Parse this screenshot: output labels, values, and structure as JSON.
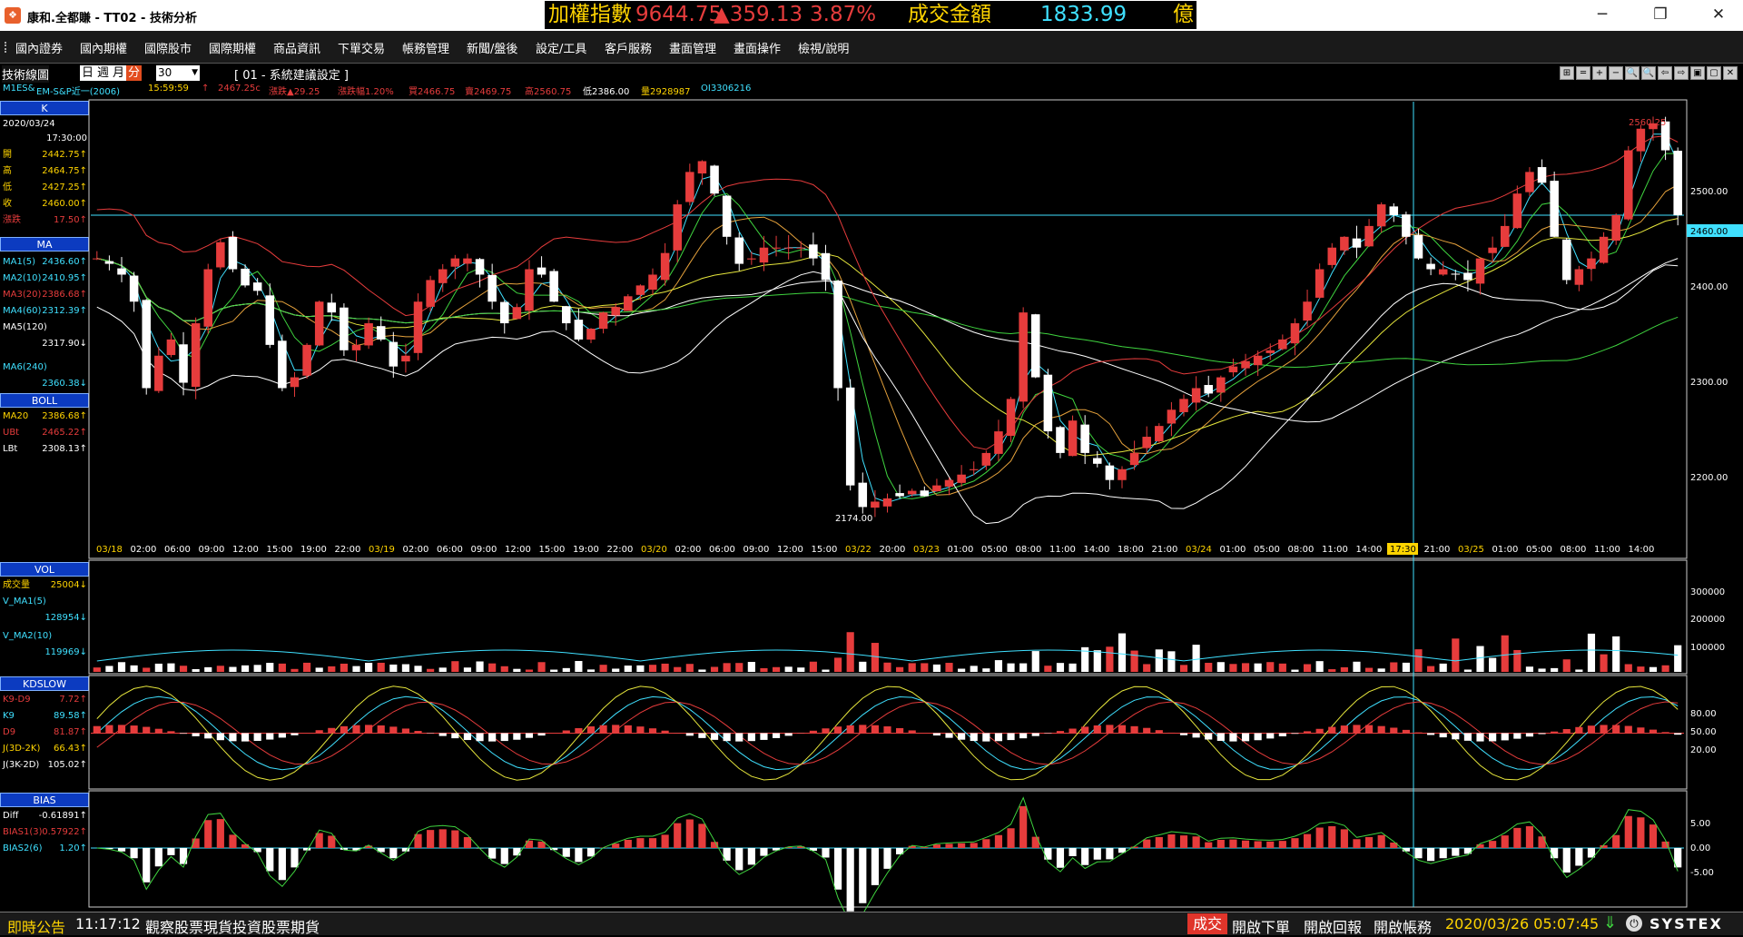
{
  "window": {
    "title": "康和.全都賺 - TT02 - 技術分析",
    "logo_glyph": "❖",
    "controls": {
      "minimize": "─",
      "maximize": "❐",
      "close": "✕"
    }
  },
  "ticker": {
    "name": "加權指數",
    "value": "9644.75",
    "change": "▲359.13",
    "percent": "3.87%",
    "amount_label": "成交金額",
    "amount": "1833.99",
    "unit": "億",
    "colors": {
      "name": "#ffd400",
      "value": "#e63c3c",
      "amount": "#3fe0ff"
    }
  },
  "menu": [
    "國內證券",
    "國內期權",
    "國際股市",
    "國際期權",
    "商品資訊",
    "下單交易",
    "帳務管理",
    "新聞/盤後",
    "設定/工具",
    "客戶服務",
    "畫面管理",
    "畫面操作",
    "檢視/說明"
  ],
  "toolbar": {
    "panel_title": "技術線圖",
    "periods": [
      "日",
      "週",
      "月",
      "分"
    ],
    "selected_period": "分",
    "interval": "30",
    "system_label": "[ 01 - 系統建議設定 ]",
    "icons": [
      "⊞",
      "═",
      "+",
      "−",
      "🔍",
      "🔍",
      "⇦",
      "⇨",
      "▣",
      "▢",
      "✕"
    ]
  },
  "quote": {
    "symbol": "M1ES&",
    "name": "EM-S&P近一(2006)",
    "time": "15:59:59",
    "arrow": "↑",
    "last": "2467.25c",
    "change": "漲跌▲29.25",
    "pct": "漲跌幅1.20%",
    "bid": "買2466.75",
    "ask": "賣2469.75",
    "high": "高2560.75",
    "low": "低2386.00",
    "volume": "量2928987",
    "oi": "OI3306216"
  },
  "left_panel": {
    "k": {
      "title": "K",
      "date": "2020/03/24",
      "time": "17:30:00",
      "rows": [
        {
          "label": "開",
          "value": "2442.75↑"
        },
        {
          "label": "高",
          "value": "2464.75↑"
        },
        {
          "label": "低",
          "value": "2427.25↑"
        },
        {
          "label": "收",
          "value": "2460.00↑"
        },
        {
          "label": "漲跌",
          "value": "17.50↑"
        }
      ]
    },
    "ma": {
      "title": "MA",
      "rows": [
        {
          "label": "MA1(5)",
          "value": "2436.60↑"
        },
        {
          "label": "MA2(10)",
          "value": "2410.95↑"
        },
        {
          "label": "MA3(20)",
          "value": "2386.68↑"
        },
        {
          "label": "MA4(60)",
          "value": "2312.39↑"
        },
        {
          "label": "MA5(120)",
          "value": ""
        },
        {
          "label": "",
          "value": "2317.90↓"
        },
        {
          "label": "MA6(240)",
          "value": ""
        },
        {
          "label": "",
          "value": "2360.38↓"
        }
      ]
    },
    "boll": {
      "title": "BOLL",
      "rows": [
        {
          "label": "MA20",
          "value": "2386.68↑"
        },
        {
          "label": "UBt",
          "value": "2465.22↑"
        },
        {
          "label": "LBt",
          "value": "2308.13↑"
        }
      ]
    },
    "vol": {
      "title": "VOL",
      "rows": [
        {
          "label": "成交量",
          "value": "25004↓"
        },
        {
          "label": "V_MA1(5)",
          "value": ""
        },
        {
          "label": "",
          "value": "128954↓"
        },
        {
          "label": "V_MA2(10)",
          "value": ""
        },
        {
          "label": "",
          "value": "119969↓"
        }
      ]
    },
    "kd": {
      "title": "KDSLOW",
      "rows": [
        {
          "label": "K9-D9",
          "value": "7.72↑"
        },
        {
          "label": "K9",
          "value": "89.58↑"
        },
        {
          "label": "D9",
          "value": "81.87↑"
        },
        {
          "label": "J(3D-2K)",
          "value": "66.43↑"
        },
        {
          "label": "J(3K-2D)",
          "value": "105.02↑"
        }
      ]
    },
    "bias": {
      "title": "BIAS",
      "rows": [
        {
          "label": "Diff",
          "value": "-0.61891↑"
        },
        {
          "label": "BIAS1(3)",
          "value": "0.57922↑"
        },
        {
          "label": "BIAS2(6)",
          "value": "1.20↑"
        }
      ]
    }
  },
  "chart_data": {
    "type": "candlestick",
    "price_axis_ticks": [
      "2500.00",
      "2400.00",
      "2300.00",
      "2200.00"
    ],
    "price_ylim": [
      2145,
      2565
    ],
    "current_price_label": "2460.00",
    "high_label": "2560.25",
    "low_label": "2174.00",
    "time_labels": [
      "03/18",
      "02:00",
      "06:00",
      "09:00",
      "12:00",
      "15:00",
      "19:00",
      "22:00",
      "03/19",
      "02:00",
      "06:00",
      "09:00",
      "12:00",
      "15:00",
      "19:00",
      "22:00",
      "03/20",
      "02:00",
      "06:00",
      "09:00",
      "12:00",
      "15:00",
      "03/22",
      "20:00",
      "03/23",
      "01:00",
      "05:00",
      "08:00",
      "11:00",
      "14:00",
      "18:00",
      "21:00",
      "03/24",
      "01:00",
      "05:00",
      "08:00",
      "11:00",
      "14:00",
      "17:30",
      "21:00",
      "03/25",
      "01:00",
      "05:00",
      "08:00",
      "11:00",
      "14:00"
    ],
    "highlighted_time_label": "17:30",
    "vol_axis_ticks": [
      "300000",
      "200000",
      "100000"
    ],
    "kd_axis_ticks": [
      "80.00",
      "50.00",
      "20.00"
    ],
    "bias_axis_ticks": [
      "5.00",
      "0.00",
      "-5.00"
    ],
    "close_path": [
      2420,
      2415,
      2405,
      2380,
      2300,
      2330,
      2345,
      2305,
      2360,
      2410,
      2435,
      2410,
      2395,
      2390,
      2340,
      2300,
      2310,
      2340,
      2380,
      2370,
      2335,
      2340,
      2360,
      2345,
      2320,
      2330,
      2380,
      2400,
      2410,
      2420,
      2420,
      2405,
      2380,
      2360,
      2375,
      2410,
      2405,
      2380,
      2360,
      2345,
      2355,
      2370,
      2375,
      2385,
      2395,
      2405,
      2425,
      2470,
      2500,
      2510,
      2480,
      2440,
      2415,
      2420,
      2430,
      2430,
      2430,
      2430,
      2420,
      2400,
      2300,
      2210,
      2190,
      2195,
      2198,
      2200,
      2205,
      2200,
      2210,
      2215,
      2220,
      2225,
      2240,
      2260,
      2290,
      2370,
      2310,
      2260,
      2240,
      2270,
      2240,
      2230,
      2215,
      2225,
      2240,
      2255,
      2265,
      2280,
      2290,
      2300,
      2295,
      2310,
      2320,
      2325,
      2330,
      2335,
      2345,
      2360,
      2380,
      2410,
      2430,
      2440,
      2430,
      2450,
      2470,
      2460,
      2440,
      2420,
      2410,
      2410,
      2405,
      2400,
      2420,
      2430,
      2450,
      2480,
      2500,
      2490,
      2440,
      2400,
      2410,
      2420,
      2440,
      2460,
      2520,
      2540,
      2545,
      2520,
      2460
    ]
  },
  "status": {
    "news_label": "即時公告",
    "time": "11:17:12",
    "message": "觀察股票現貨投資股票期貨",
    "trade": "成交",
    "buttons": [
      "開啟下單",
      "開啟回報",
      "開啟帳務"
    ],
    "clock": "2020/03/26 05:07:45",
    "brand": "SYSTEX"
  }
}
